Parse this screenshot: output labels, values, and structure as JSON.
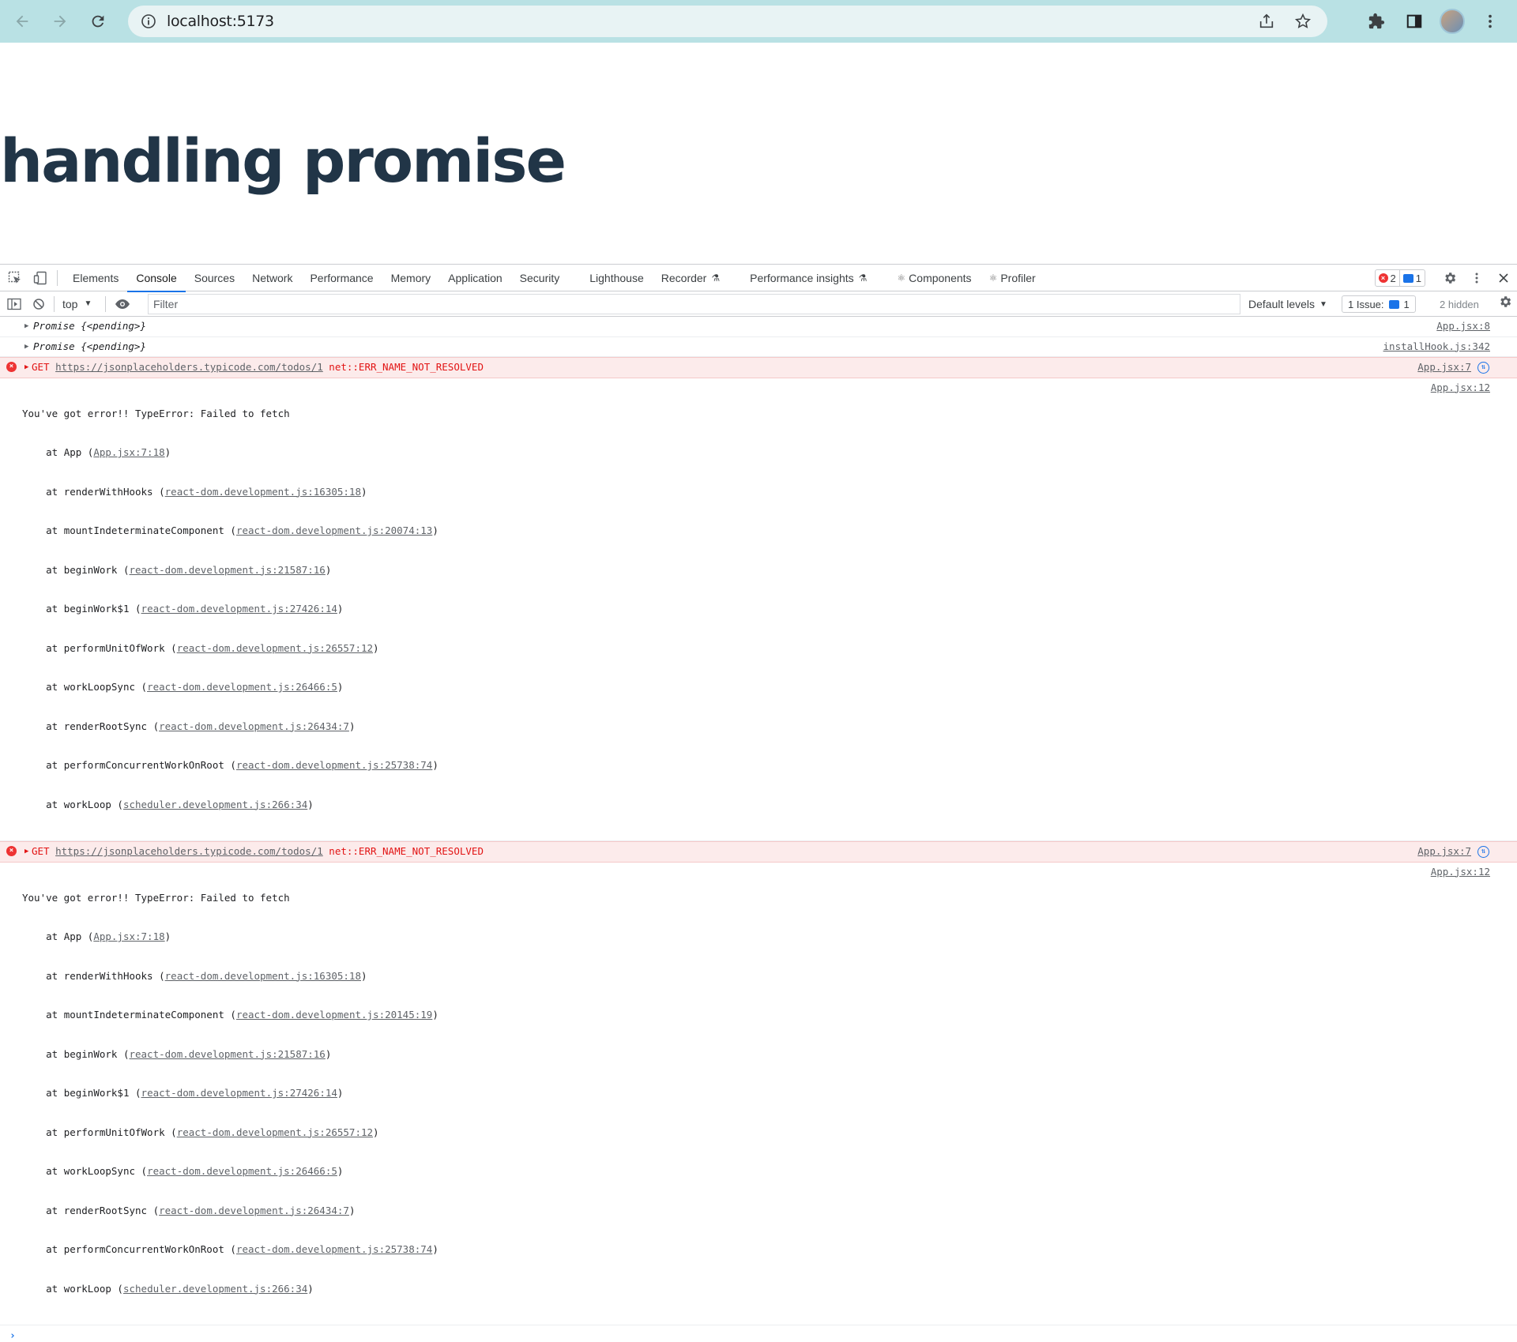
{
  "browser": {
    "url": "localhost:5173",
    "icons": [
      "back-icon",
      "forward-icon",
      "reload-icon",
      "info-icon",
      "share-icon",
      "star-icon",
      "extensions-icon",
      "side-panel-icon",
      "avatar",
      "menu-icon"
    ]
  },
  "page": {
    "heading": "handling promise"
  },
  "devtools": {
    "tabs": [
      "Elements",
      "Console",
      "Sources",
      "Network",
      "Performance",
      "Memory",
      "Application",
      "Security",
      "Lighthouse",
      "Recorder",
      "Performance insights",
      "Components",
      "Profiler"
    ],
    "active_tab": "Console",
    "error_count": "2",
    "message_count": "1",
    "toolbar": {
      "context": "top",
      "filter_placeholder": "Filter",
      "levels": "Default levels",
      "issues_label": "1 Issue:",
      "issues_count": "1",
      "hidden": "2 hidden"
    },
    "messages": [
      {
        "kind": "log",
        "text": "Promise {<pending>}",
        "source": "App.jsx:8"
      },
      {
        "kind": "log",
        "text": "Promise {<pending>}",
        "source": "installHook.js:342"
      },
      {
        "kind": "error",
        "method": "GET",
        "url": "https://jsonplaceholders.typicode.com/todos/1",
        "error": "net::ERR_NAME_NOT_RESOLVED",
        "source": "App.jsx:7"
      },
      {
        "kind": "stack",
        "text": "You've got error!! TypeError: Failed to fetch",
        "source": "App.jsx:12",
        "frames": [
          {
            "fn": "App",
            "loc": "App.jsx:7:18"
          },
          {
            "fn": "renderWithHooks",
            "loc": "react-dom.development.js:16305:18"
          },
          {
            "fn": "mountIndeterminateComponent",
            "loc": "react-dom.development.js:20074:13"
          },
          {
            "fn": "beginWork",
            "loc": "react-dom.development.js:21587:16"
          },
          {
            "fn": "beginWork$1",
            "loc": "react-dom.development.js:27426:14"
          },
          {
            "fn": "performUnitOfWork",
            "loc": "react-dom.development.js:26557:12"
          },
          {
            "fn": "workLoopSync",
            "loc": "react-dom.development.js:26466:5"
          },
          {
            "fn": "renderRootSync",
            "loc": "react-dom.development.js:26434:7"
          },
          {
            "fn": "performConcurrentWorkOnRoot",
            "loc": "react-dom.development.js:25738:74"
          },
          {
            "fn": "workLoop",
            "loc": "scheduler.development.js:266:34"
          }
        ]
      },
      {
        "kind": "error",
        "method": "GET",
        "url": "https://jsonplaceholders.typicode.com/todos/1",
        "error": "net::ERR_NAME_NOT_RESOLVED",
        "source": "App.jsx:7"
      },
      {
        "kind": "stack",
        "text": "You've got error!! TypeError: Failed to fetch",
        "source": "App.jsx:12",
        "frames": [
          {
            "fn": "App",
            "loc": "App.jsx:7:18"
          },
          {
            "fn": "renderWithHooks",
            "loc": "react-dom.development.js:16305:18"
          },
          {
            "fn": "mountIndeterminateComponent",
            "loc": "react-dom.development.js:20145:19"
          },
          {
            "fn": "beginWork",
            "loc": "react-dom.development.js:21587:16"
          },
          {
            "fn": "beginWork$1",
            "loc": "react-dom.development.js:27426:14"
          },
          {
            "fn": "performUnitOfWork",
            "loc": "react-dom.development.js:26557:12"
          },
          {
            "fn": "workLoopSync",
            "loc": "react-dom.development.js:26466:5"
          },
          {
            "fn": "renderRootSync",
            "loc": "react-dom.development.js:26434:7"
          },
          {
            "fn": "performConcurrentWorkOnRoot",
            "loc": "react-dom.development.js:25738:74"
          },
          {
            "fn": "workLoop",
            "loc": "scheduler.development.js:266:34"
          }
        ]
      }
    ],
    "prompt_symbol": "›"
  }
}
